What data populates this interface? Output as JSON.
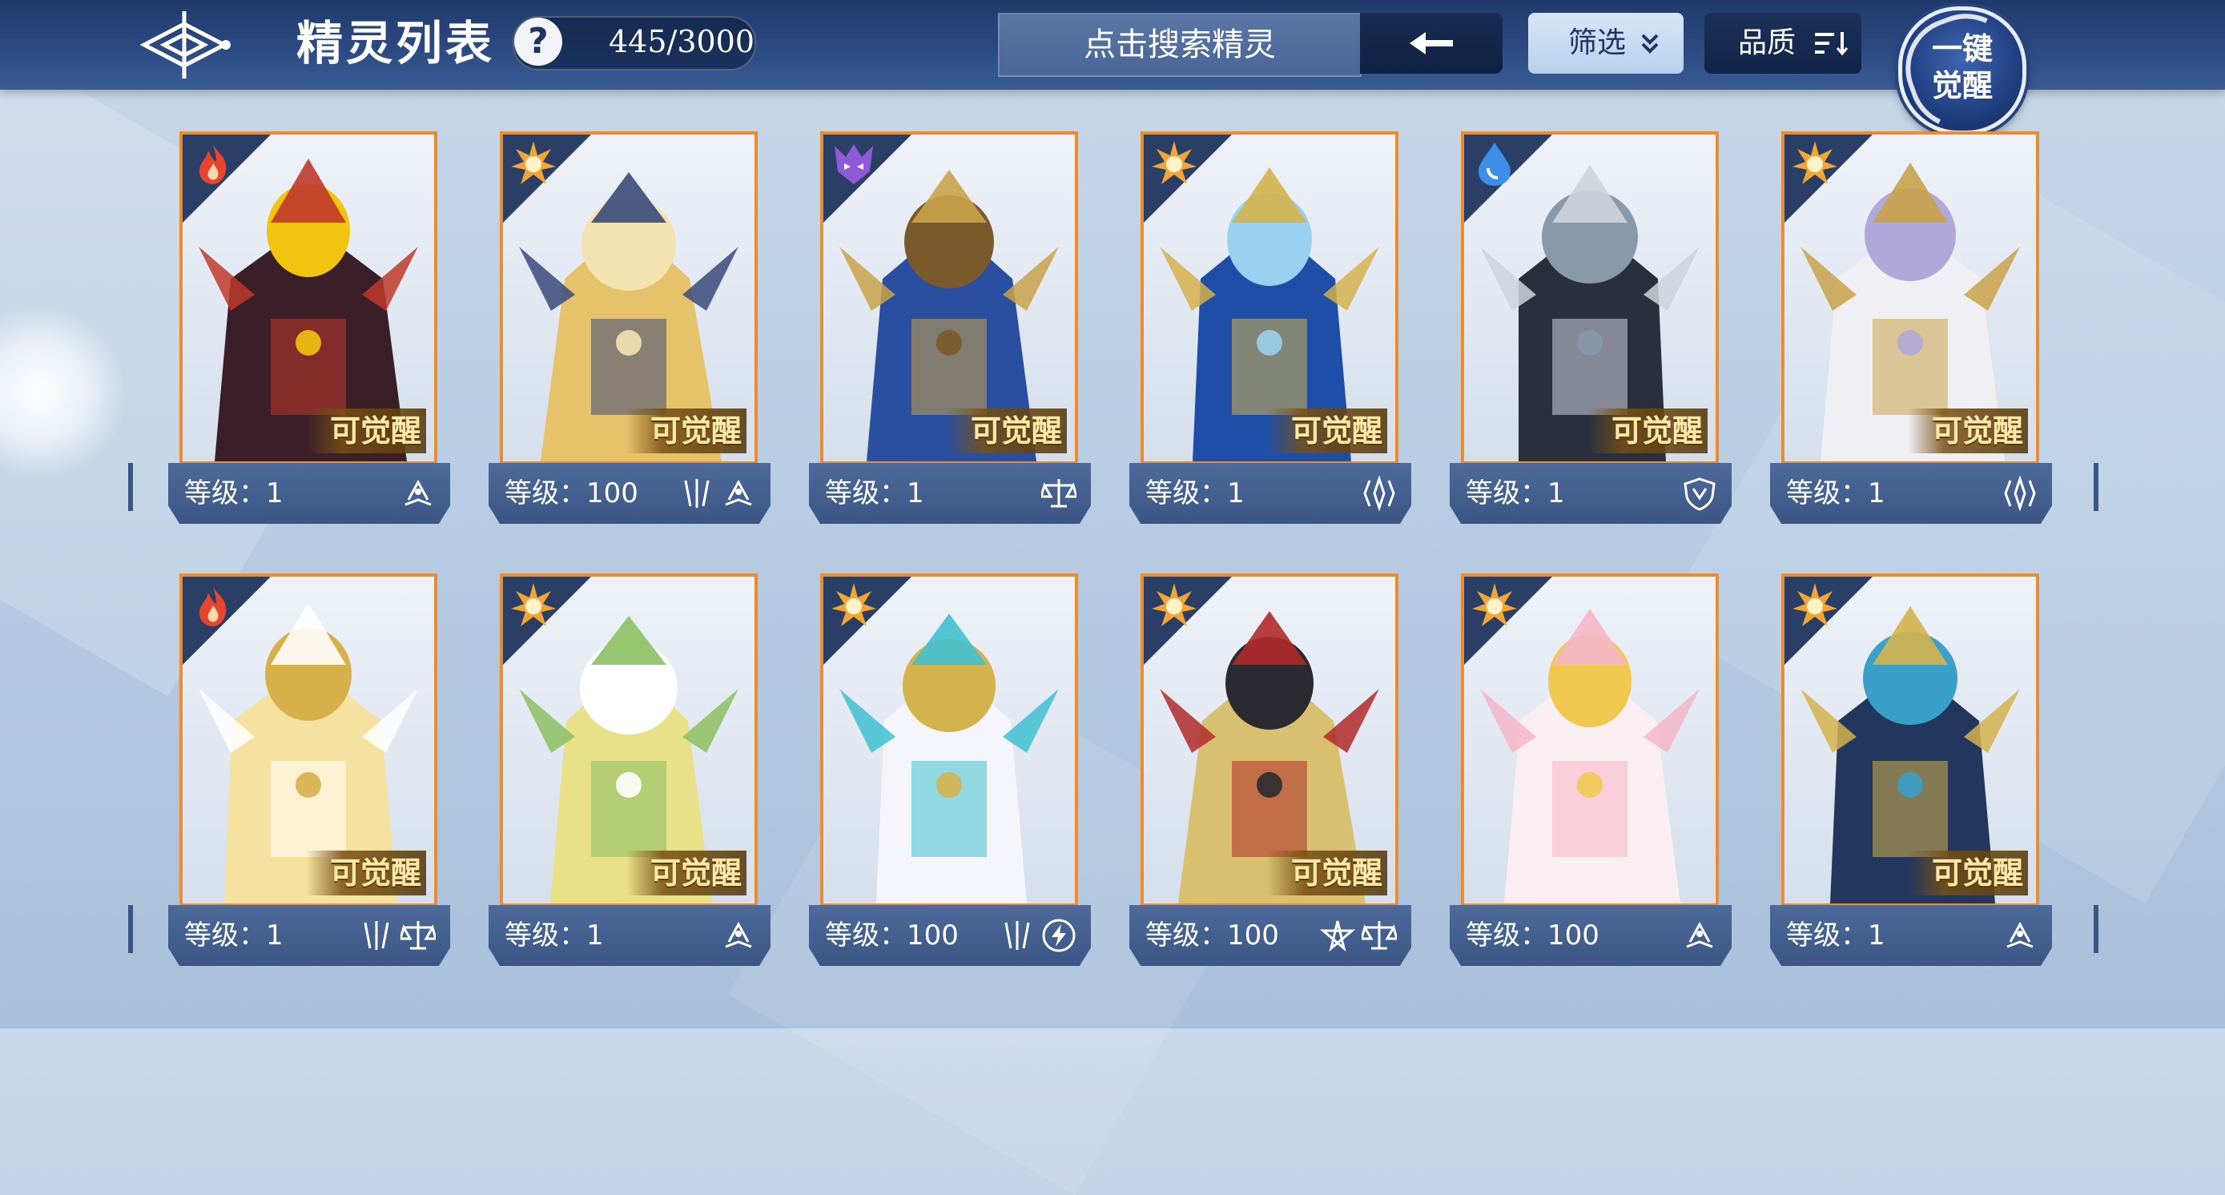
{
  "header": {
    "title": "精灵列表",
    "help_label": "?",
    "count": "445/3000",
    "search_placeholder": "点击搜索精灵",
    "filter_label": "筛选",
    "quality_label": "品质",
    "awaken_line1": "一键",
    "awaken_line2": "觉醒"
  },
  "cards": [
    {
      "level_prefix": "等级：",
      "level": "1",
      "badge": "可觉醒",
      "element": "fire-icon",
      "skills": [
        "book-icon"
      ]
    },
    {
      "level_prefix": "等级：",
      "level": "100",
      "badge": "可觉醒",
      "element": "sun-icon",
      "skills": [
        "claw-icon",
        "book-icon"
      ]
    },
    {
      "level_prefix": "等级：",
      "level": "1",
      "badge": "可觉醒",
      "element": "demon-icon",
      "skills": [
        "scale-icon"
      ]
    },
    {
      "level_prefix": "等级：",
      "level": "1",
      "badge": "可觉醒",
      "element": "sun-icon",
      "skills": [
        "crystal-icon"
      ]
    },
    {
      "level_prefix": "等级：",
      "level": "1",
      "badge": "可觉醒",
      "element": "water-icon",
      "skills": [
        "shield-icon"
      ]
    },
    {
      "level_prefix": "等级：",
      "level": "1",
      "badge": "可觉醒",
      "element": "sun-icon",
      "skills": [
        "crystal-icon"
      ]
    },
    {
      "level_prefix": "等级：",
      "level": "1",
      "badge": "可觉醒",
      "element": "fire-icon",
      "skills": [
        "claw-icon",
        "scale-icon"
      ]
    },
    {
      "level_prefix": "等级：",
      "level": "1",
      "badge": "可觉醒",
      "element": "sun-icon",
      "skills": [
        "book-icon"
      ]
    },
    {
      "level_prefix": "等级：",
      "level": "100",
      "badge": "",
      "element": "sun-icon",
      "skills": [
        "claw-icon",
        "lightning-icon"
      ]
    },
    {
      "level_prefix": "等级：",
      "level": "100",
      "badge": "可觉醒",
      "element": "sun-icon",
      "skills": [
        "star-icon",
        "scale-icon"
      ]
    },
    {
      "level_prefix": "等级：",
      "level": "100",
      "badge": "",
      "element": "sun-icon",
      "skills": [
        "book-icon"
      ]
    },
    {
      "level_prefix": "等级：",
      "level": "1",
      "badge": "可觉醒",
      "element": "sun-icon",
      "skills": [
        "book-icon"
      ]
    }
  ],
  "colors": {
    "frame": "#f08b2a",
    "fire": "#e8452f",
    "sun": "#f3a634",
    "demon": "#8e5ad8",
    "water": "#3c8ee8"
  },
  "art_palettes": [
    [
      "#3a1e28",
      "#c0392b",
      "#f1c40f"
    ],
    [
      "#e6c26a",
      "#3a4a7a",
      "#f3e3b0"
    ],
    [
      "#2b4fa0",
      "#c9a24a",
      "#7a5a2a"
    ],
    [
      "#1e4ea8",
      "#d4b24c",
      "#9ad0f0"
    ],
    [
      "#2a2f3e",
      "#cfd4dc",
      "#8899aa"
    ],
    [
      "#f0f0f4",
      "#c9a24a",
      "#b0a8d8"
    ],
    [
      "#f5e2a0",
      "#ffffff",
      "#d8b04a"
    ],
    [
      "#e9e08a",
      "#8cc060",
      "#ffffff"
    ],
    [
      "#f4f6fb",
      "#40c0d0",
      "#d4b24c"
    ],
    [
      "#d8c070",
      "#b02a2a",
      "#2a2a30"
    ],
    [
      "#fbeef2",
      "#f5b6c8",
      "#f0c850"
    ],
    [
      "#22365e",
      "#d4b24c",
      "#3aa0c8"
    ]
  ]
}
